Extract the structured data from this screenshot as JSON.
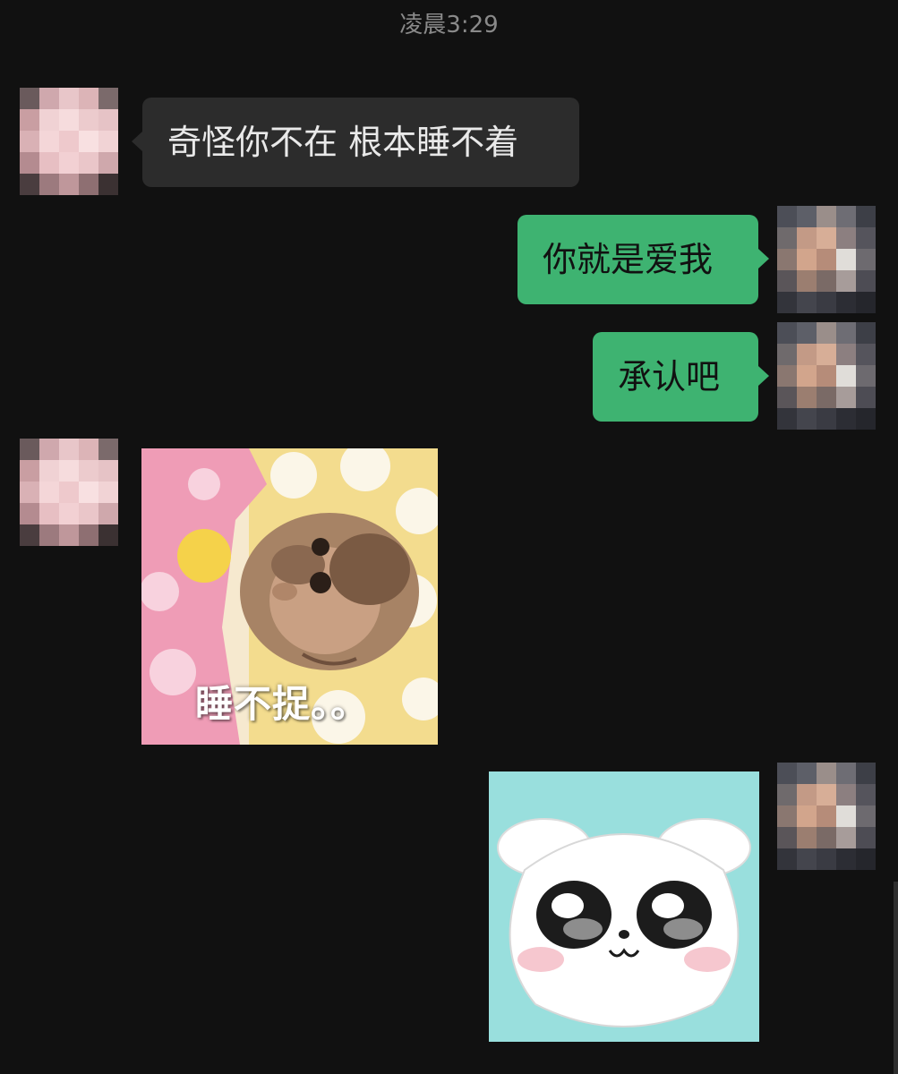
{
  "chat": {
    "timestamp": "凌晨3:29",
    "messages": [
      {
        "side": "incoming",
        "type": "text",
        "text": "奇怪你不在 根本睡不着"
      },
      {
        "side": "outgoing",
        "type": "text",
        "text": "你就是爱我"
      },
      {
        "side": "outgoing",
        "type": "text",
        "text": "承认吧"
      },
      {
        "side": "incoming",
        "type": "sticker",
        "sticker": "sleepy-monkey-sticker",
        "caption": "睡不捉。。"
      },
      {
        "side": "outgoing",
        "type": "sticker",
        "sticker": "white-puppy-face-sticker"
      }
    ]
  },
  "colors": {
    "background": "#111111",
    "incoming_bubble": "#2c2c2c",
    "outgoing_bubble": "#3eb371",
    "timestamp_text": "#8a8a8a"
  }
}
